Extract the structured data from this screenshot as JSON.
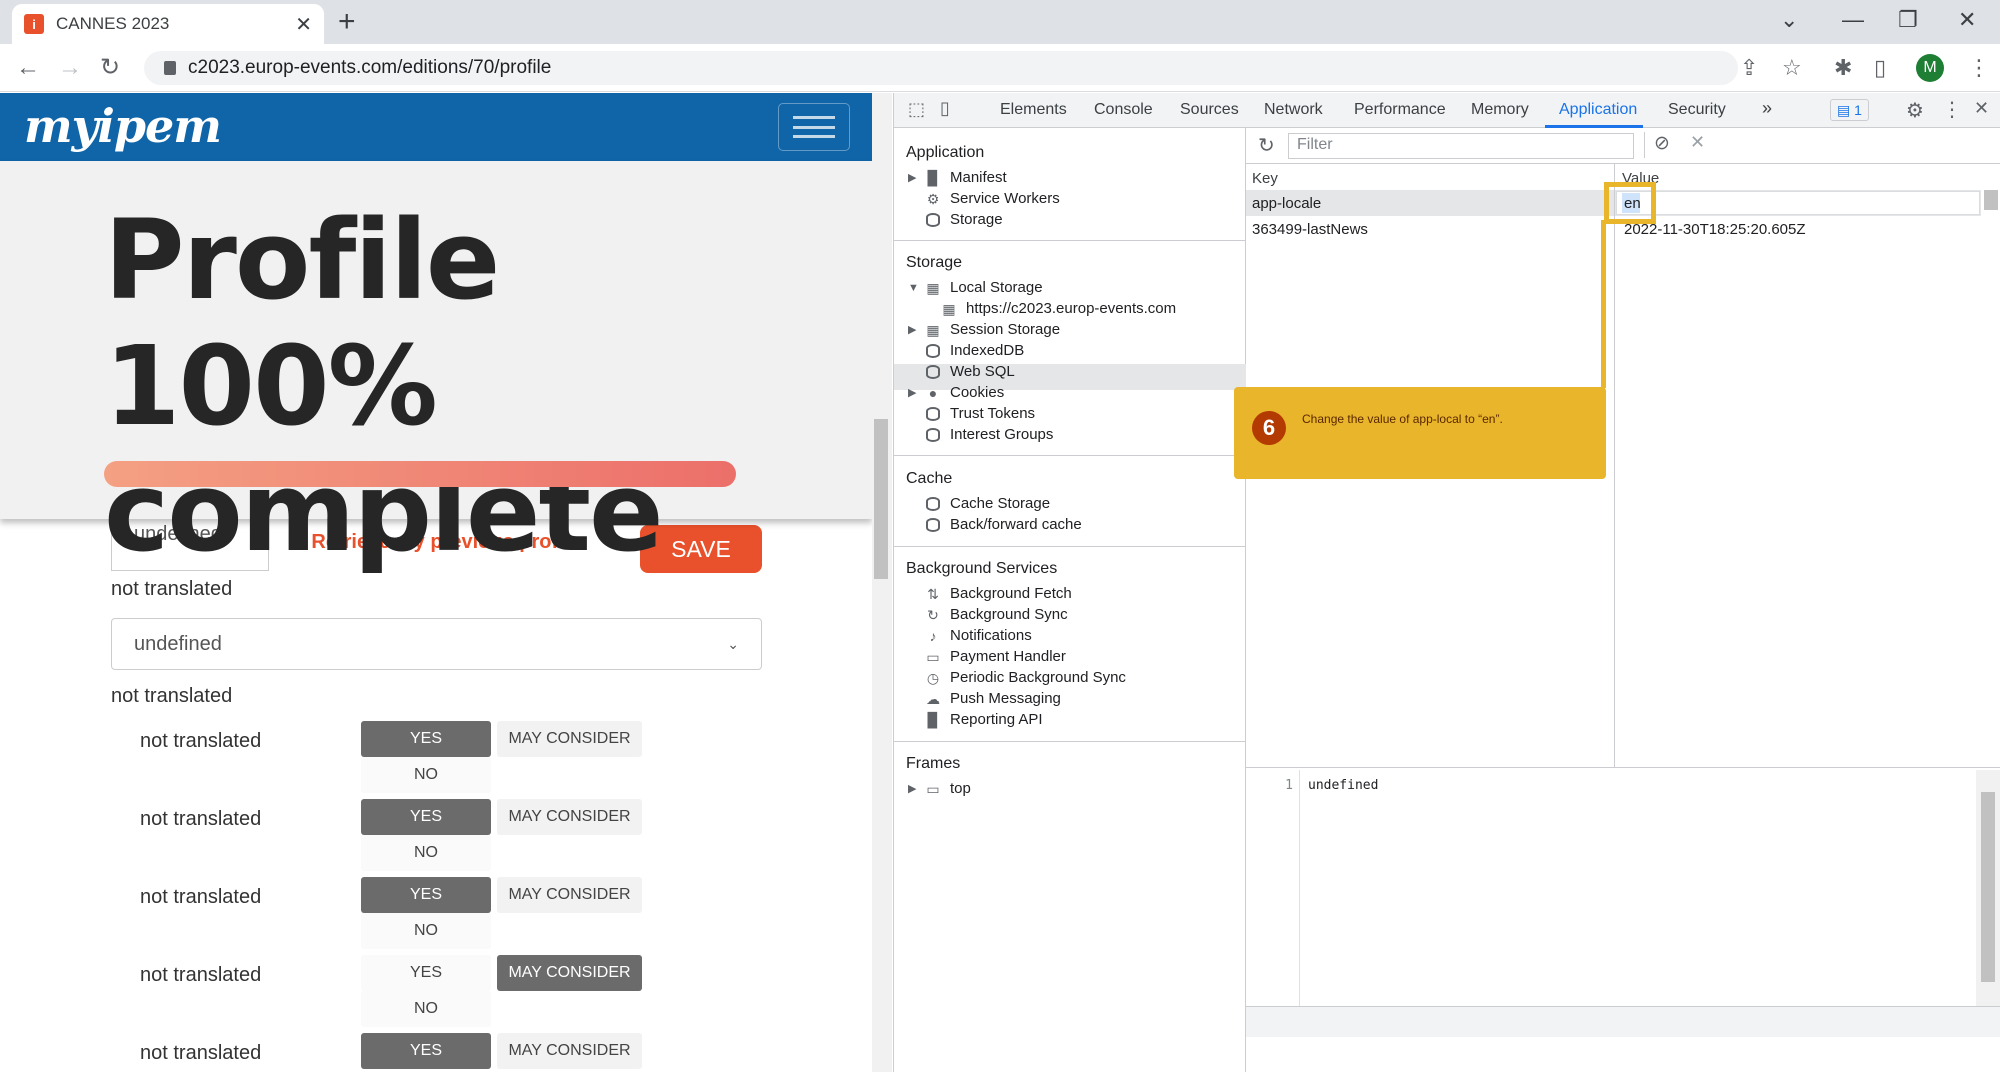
{
  "browser": {
    "tab_title": "CANNES 2023",
    "tab_close": "✕",
    "new_tab": "+",
    "url": "c2023.europ-events.com/editions/70/profile",
    "avatar_initial": "M",
    "window_controls": {
      "tabsearch": "⌄",
      "minimize": "—",
      "restore": "❐",
      "close": "✕"
    }
  },
  "page": {
    "logo_text": "myipem",
    "headline": "Profile 100% complete",
    "progress_percent": 100,
    "profile_input_value": "undefined",
    "retrieve_label": "Retrieve my previous profile",
    "save_label": "SAVE",
    "field_label_1": "not translated",
    "select_value": "undefined",
    "field_label_2": "not translated",
    "questions": [
      {
        "label": "not translated",
        "yes": "YES",
        "maybe": "MAY CONSIDER",
        "no": "NO",
        "selected": "yes"
      },
      {
        "label": "not translated",
        "yes": "YES",
        "maybe": "MAY CONSIDER",
        "no": "NO",
        "selected": "yes"
      },
      {
        "label": "not translated",
        "yes": "YES",
        "maybe": "MAY CONSIDER",
        "no": "NO",
        "selected": "yes"
      },
      {
        "label": "not translated",
        "yes": "YES",
        "maybe": "MAY CONSIDER",
        "no": "NO",
        "selected": "maybe"
      },
      {
        "label": "not translated",
        "yes": "YES",
        "maybe": "MAY CONSIDER",
        "no": "NO",
        "selected": "yes"
      }
    ]
  },
  "devtools": {
    "tabs": [
      "Elements",
      "Console",
      "Sources",
      "Network",
      "Performance",
      "Memory",
      "Application",
      "Security"
    ],
    "active_tab": "Application",
    "more_tabs": "»",
    "issues_count": "1",
    "sidebar": {
      "application_title": "Application",
      "application_items": [
        "Manifest",
        "Service Workers",
        "Storage"
      ],
      "storage_title": "Storage",
      "local_storage": "Local Storage",
      "local_storage_origin": "https://c2023.europ-events.com",
      "storage_items": [
        "Session Storage",
        "IndexedDB",
        "Web SQL",
        "Cookies",
        "Trust Tokens",
        "Interest Groups"
      ],
      "cache_title": "Cache",
      "cache_items": [
        "Cache Storage",
        "Back/forward cache"
      ],
      "bg_title": "Background Services",
      "bg_items": [
        "Background Fetch",
        "Background Sync",
        "Notifications",
        "Payment Handler",
        "Periodic Background Sync",
        "Push Messaging",
        "Reporting API"
      ],
      "frames_title": "Frames",
      "frames_items": [
        "top"
      ]
    },
    "filter_placeholder": "Filter",
    "table": {
      "key_header": "Key",
      "value_header": "Value",
      "rows": [
        {
          "key": "app-locale",
          "value": "en"
        },
        {
          "key": "363499-lastNews",
          "value": "2022-11-30T18:25:20.605Z"
        }
      ]
    },
    "preview": {
      "line_number": "1",
      "line_text": "undefined"
    }
  },
  "annotation": {
    "step": "6",
    "text": "Change the value of app-local to “en”.",
    "color": "#e9b52b"
  },
  "colors": {
    "header_blue": "#1065a8",
    "accent_orange": "#e8512b",
    "devtools_active": "#1a73e8"
  }
}
